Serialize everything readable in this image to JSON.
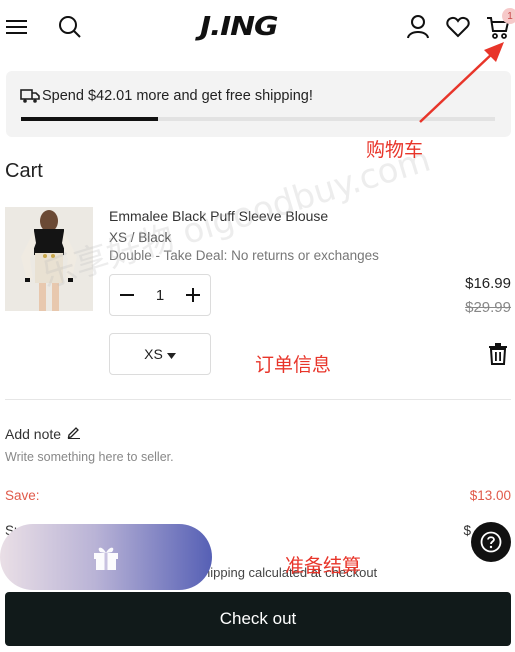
{
  "header": {
    "menu_icon": "hamburger-menu-icon",
    "search_icon": "search-icon",
    "logo_text": "J.ING",
    "account_icon": "user-icon",
    "wishlist_icon": "heart-icon",
    "cart_icon": "cart-icon",
    "cart_count": "1"
  },
  "shipping_banner": {
    "icon": "truck-icon",
    "text": "Spend $42.01 more and get free shipping!",
    "progress": 0.29
  },
  "cart": {
    "title": "Cart",
    "items": [
      {
        "name": "Emmalee Black Puff Sleeve Blouse",
        "variant": "XS / Black",
        "deal": "Double - Take Deal: No returns or exchanges",
        "quantity": "1",
        "size": "XS",
        "price": "$16.99",
        "compare_price": "$29.99"
      }
    ]
  },
  "note": {
    "label": "Add note",
    "placeholder": "Write something here to seller."
  },
  "summary": {
    "save_label": "Save:",
    "save_value": "$13.00",
    "subtotal_label": "Su",
    "subtotal_value": "$",
    "shipping_note": "hipping calculated at checkout"
  },
  "checkout_label": "Check out",
  "annotations": {
    "cart": "购物车",
    "order_info": "订单信息",
    "checkout": "准备结算",
    "watermark": "乐享好物 oigoodbuy.com"
  },
  "colors": {
    "accent": "#e05a4a",
    "annotation": "#e8352a",
    "checkout_bg": "#111a1a"
  }
}
